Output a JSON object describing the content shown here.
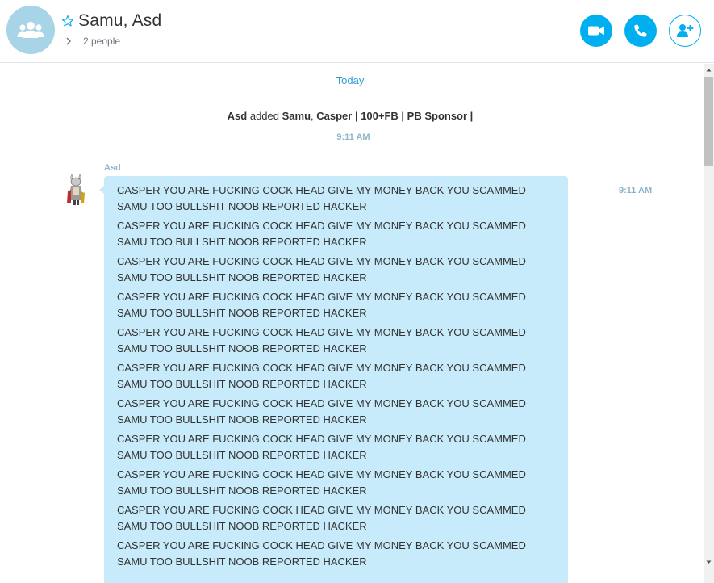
{
  "header": {
    "title": "Samu, Asd",
    "participants": "2 people",
    "icons": {
      "group_avatar": "group-icon",
      "favorite": "star-icon",
      "expand": "chevron-right-icon",
      "video": "video-camera-icon",
      "call": "phone-icon",
      "add_people": "add-person-icon"
    }
  },
  "conversation": {
    "day_label": "Today",
    "system_message": {
      "actor": "Asd",
      "verb": " added ",
      "target1": "Samu",
      "separator": ", ",
      "target2": "Casper | 100+FB | PB Sponsor |",
      "time": "9:11 AM"
    },
    "message": {
      "sender": "Asd",
      "time": "9:11 AM",
      "lines": [
        "CASPER YOU ARE FUCKING COCK HEAD GIVE MY MONEY BACK YOU SCAMMED SAMU TOO BULLSHIT NOOB REPORTED HACKER",
        "CASPER YOU ARE FUCKING COCK HEAD GIVE MY MONEY BACK YOU SCAMMED SAMU TOO BULLSHIT NOOB REPORTED HACKER",
        "CASPER YOU ARE FUCKING COCK HEAD GIVE MY MONEY BACK YOU SCAMMED SAMU TOO BULLSHIT NOOB REPORTED HACKER",
        "CASPER YOU ARE FUCKING COCK HEAD GIVE MY MONEY BACK YOU SCAMMED SAMU TOO BULLSHIT NOOB REPORTED HACKER",
        "CASPER YOU ARE FUCKING COCK HEAD GIVE MY MONEY BACK YOU SCAMMED SAMU TOO BULLSHIT NOOB REPORTED HACKER",
        "CASPER YOU ARE FUCKING COCK HEAD GIVE MY MONEY BACK YOU SCAMMED SAMU TOO BULLSHIT NOOB REPORTED HACKER",
        "CASPER YOU ARE FUCKING COCK HEAD GIVE MY MONEY BACK YOU SCAMMED SAMU TOO BULLSHIT NOOB REPORTED HACKER",
        "CASPER YOU ARE FUCKING COCK HEAD GIVE MY MONEY BACK YOU SCAMMED SAMU TOO BULLSHIT NOOB REPORTED HACKER",
        "CASPER YOU ARE FUCKING COCK HEAD GIVE MY MONEY BACK YOU SCAMMED SAMU TOO BULLSHIT NOOB REPORTED HACKER",
        "CASPER YOU ARE FUCKING COCK HEAD GIVE MY MONEY BACK YOU SCAMMED SAMU TOO BULLSHIT NOOB REPORTED HACKER",
        "CASPER YOU ARE FUCKING COCK HEAD GIVE MY MONEY BACK YOU SCAMMED SAMU TOO BULLSHIT NOOB REPORTED HACKER"
      ]
    }
  },
  "colors": {
    "accent": "#00aff0",
    "bubble": "#c7ebfa",
    "timestamp": "#8fb5c8",
    "day_label": "#2c9fcf"
  }
}
